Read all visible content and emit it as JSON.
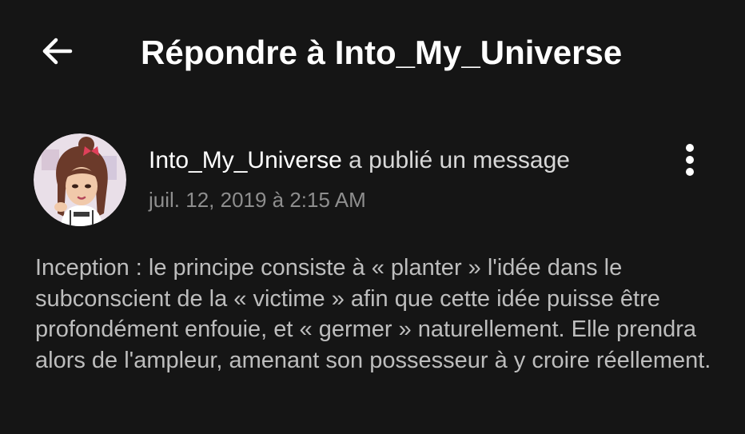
{
  "header": {
    "back_icon": "arrow-left-icon",
    "title": "Répondre à Into_My_Universe"
  },
  "post": {
    "avatar_icon": "user-avatar-illustration",
    "author": "Into_My_Universe",
    "action": " a publié un message",
    "timestamp": "juil. 12, 2019 à 2:15 AM",
    "more_icon": "more-vertical-icon",
    "body": "Inception : le principe consiste à « planter » l'idée dans le subconscient de la « victime » afin que cette idée puisse être profondément enfouie, et « germer » naturellement. Elle prendra alors de l'ampleur, amenant son possesseur à y croire réellement."
  },
  "colors": {
    "background": "#151515",
    "title": "#ffffff",
    "timestamp": "#8e8e8e",
    "body_text": "#bdbdbd"
  }
}
